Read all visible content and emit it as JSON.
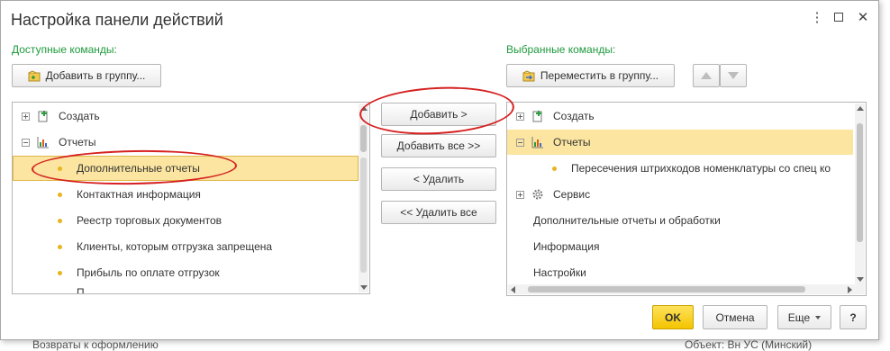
{
  "window": {
    "title": "Настройка панели действий"
  },
  "left": {
    "label": "Доступные команды:",
    "add_to_group": "Добавить в группу...",
    "items": [
      {
        "type": "group",
        "label": "Создать",
        "expander": "plus",
        "icon": "create-icon"
      },
      {
        "type": "group",
        "label": "Отчеты",
        "expander": "minus",
        "icon": "reports-icon"
      },
      {
        "type": "item",
        "label": "Дополнительные отчеты"
      },
      {
        "type": "item",
        "label": "Контактная информация"
      },
      {
        "type": "item",
        "label": "Реестр торговых документов"
      },
      {
        "type": "item",
        "label": "Клиенты, которым отгрузка запрещена"
      },
      {
        "type": "item",
        "label": "Прибыль по оплате отгрузок"
      },
      {
        "type": "item",
        "label": "П"
      }
    ]
  },
  "middle": {
    "add": "Добавить >",
    "add_all": "Добавить все >>",
    "remove": "< Удалить",
    "remove_all": "<< Удалить все"
  },
  "right": {
    "label": "Выбранные команды:",
    "move_to_group": "Переместить в группу...",
    "items": [
      {
        "type": "group",
        "label": "Создать",
        "expander": "plus",
        "icon": "create-icon"
      },
      {
        "type": "group",
        "label": "Отчеты",
        "expander": "minus",
        "icon": "reports-icon"
      },
      {
        "type": "item",
        "label": "Пересечения штрихкодов номенклатуры со спец ко"
      },
      {
        "type": "group",
        "label": "Сервис",
        "expander": "plus",
        "icon": "gear-icon"
      },
      {
        "type": "plain",
        "label": "Дополнительные отчеты и обработки"
      },
      {
        "type": "plain",
        "label": "Информация"
      },
      {
        "type": "plain",
        "label": "Настройки"
      }
    ]
  },
  "footer": {
    "ok": "OK",
    "cancel": "Отмена",
    "more": "Еще",
    "help": "?"
  },
  "background": {
    "bottom_left": "Возвраты к оформлению",
    "bottom_right": "Объект: Вн УС (Минский)"
  },
  "colors": {
    "section_label": "#1e9a3c",
    "selection": "#fbe5a0",
    "ok": "#f4c400",
    "annotation": "#d62020"
  }
}
